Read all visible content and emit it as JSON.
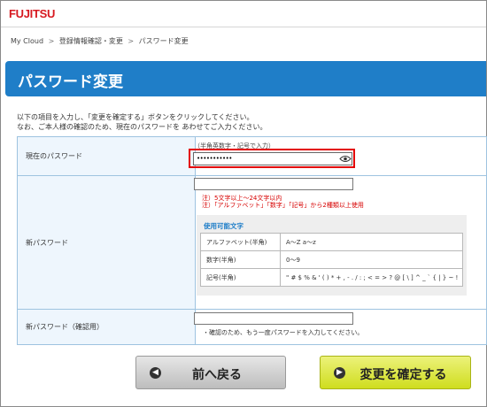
{
  "header": {
    "logo_text": "FUJITSU"
  },
  "breadcrumb": {
    "items": [
      "My Cloud",
      "登録情報確認・変更",
      "パスワード変更"
    ],
    "separator": ">"
  },
  "page": {
    "title": "パスワード変更",
    "intro_line1": "以下の項目を入力し、「変更を確定する」ボタンをクリックしてください。",
    "intro_line2": "なお、ご本人様の確認のため、現在のパスワードを あわせてご入力ください。"
  },
  "form": {
    "current_password": {
      "label": "現在のパスワード",
      "hint": "（半角英数字・記号で入力）",
      "value": "•••••••••••"
    },
    "new_password": {
      "label": "新パスワード",
      "value": "",
      "note1": "注）5文字以上～24文字以内",
      "note2": "注）「アルファベット」「数字」「記号」から2種類以上使用",
      "allowed_chars": {
        "title": "使用可能文字",
        "rows": [
          {
            "label": "アルファベット(半角)",
            "chars": "A～Z a～z"
          },
          {
            "label": "数字(半角)",
            "chars": "0～9"
          },
          {
            "label": "記号(半角)",
            "chars": "\" # $ % & ' ( ) * + , - . / : ; < = > ? @ [ \\ ] ^ _ ` { | } ~ !"
          }
        ]
      }
    },
    "confirm_password": {
      "label": "新パスワード（確認用）",
      "value": "",
      "note": "・確認のため、もう一度パスワードを入力してください。"
    }
  },
  "buttons": {
    "back_label": "前へ戻る",
    "submit_label": "変更を確定する"
  },
  "colors": {
    "brand_red": "#d71920",
    "title_bar": "#1f7ec8",
    "highlight_box": "#e30000",
    "submit_button": "#d6e22d",
    "back_button": "#cfcfcf"
  }
}
